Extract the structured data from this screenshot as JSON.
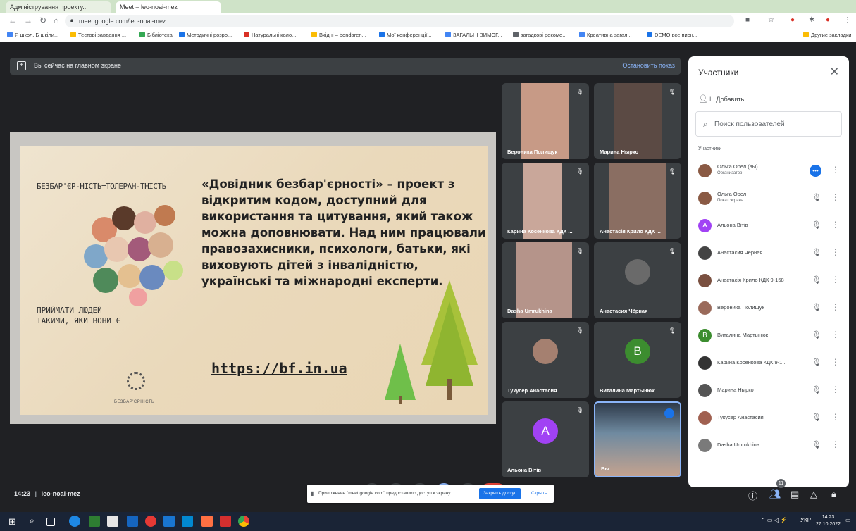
{
  "browser": {
    "tabs": [
      {
        "label": "Адміністрування проекту..."
      },
      {
        "label": "Meet – leo-noai-mez"
      }
    ],
    "url": "meet.google.com/leo-noai-mez",
    "bookmarks": [
      {
        "label": "Я школ. Б шкіли...",
        "color": "#4285f4"
      },
      {
        "label": "Тестові завдання ...",
        "color": "#fbbc04"
      },
      {
        "label": "Бібліотека",
        "color": "#34a853"
      },
      {
        "label": "Методичні розро...",
        "color": "#1a73e8"
      },
      {
        "label": "Натуральні коло...",
        "color": "#d93025"
      },
      {
        "label": "Вхідні – bondaren...",
        "color": "#fbbc04"
      },
      {
        "label": "Мої конференції...",
        "color": "#1a73e8"
      },
      {
        "label": "ЗАГАЛЬНІ ВИМОГ...",
        "color": "#4285f4"
      },
      {
        "label": "загадкові рекоме...",
        "color": "#5f6368"
      },
      {
        "label": "Креативна загал...",
        "color": "#4285f4"
      },
      {
        "label": "DEMO все писн...",
        "color": "#1a73e8"
      }
    ],
    "other_bookmarks": "Другие закладки"
  },
  "meet": {
    "present_bar": {
      "text": "Вы сейчас на главном экране",
      "stop": "Остановить показ"
    },
    "slide": {
      "hand_title": "БЕЗБАР'ЄР-НІСТЬ=ТОЛЕРАН-ТНІСТЬ",
      "hand_caption": "ПРИЙМАТИ ЛЮДЕЙ ТАКИМИ, ЯКИ ВОНИ Є",
      "main_text": "«Довідник безбар'єрності» – проект з відкритим кодом, доступний для використання та цитування, який також можна доповнювати. Над ним працювали правозахисники, психологи, батьки, які виховують дітей з інвалідністю, українські та міжнародні експерти.",
      "link": "https://bf.in.ua",
      "logo_text": "БЕЗБАР'ЄРНІСТЬ"
    },
    "tiles": [
      {
        "name": "Вероника Полищук",
        "type": "photo",
        "color": "#c79a86"
      },
      {
        "name": "Марина Ныркo",
        "type": "photo",
        "color": "#5b4a44"
      },
      {
        "name": "Карина Косенкова КДК ...",
        "type": "photo",
        "color": "#c9a79a"
      },
      {
        "name": "Анастасія Крило КДК ...",
        "type": "photo",
        "color": "#8a6e62"
      },
      {
        "name": "Dasha Umrukhina",
        "type": "photo",
        "color": "#b5948a"
      },
      {
        "name": "Анастасия Чёрная",
        "type": "photo",
        "color": "#6a6a6a"
      },
      {
        "name": "Тукусер Анастасия",
        "type": "photo",
        "color": "#a58070"
      },
      {
        "name": "Виталина Мартынюк",
        "type": "letter",
        "letter": "B",
        "color": "#3c8d2f"
      },
      {
        "name": "Альона Вітів",
        "type": "letter",
        "letter": "A",
        "color": "#a142f4"
      },
      {
        "name": "Вы",
        "type": "photo",
        "color": "#6f8aa0"
      }
    ],
    "panel": {
      "title": "Участники",
      "add": "Добавить",
      "search_placeholder": "Поиск пользователей",
      "section": "Участники",
      "people": [
        {
          "name": "Ольга Орел (вы)",
          "sub": "Организатор",
          "color": "#8a5a44",
          "state": "speaking"
        },
        {
          "name": "Ольга Орел",
          "sub": "Показ экрана",
          "color": "#8a5a44",
          "state": "present"
        },
        {
          "name": "Альона Вітів",
          "sub": "",
          "color": "#a142f4",
          "letter": "A",
          "state": "muted"
        },
        {
          "name": "Анастасия Чёрная",
          "sub": "",
          "color": "#444",
          "state": "muted"
        },
        {
          "name": "Анастасія Крило КДК 9-158",
          "sub": "",
          "color": "#7a5040",
          "state": "muted"
        },
        {
          "name": "Вероника Полищук",
          "sub": "",
          "color": "#9a6a5a",
          "state": "muted"
        },
        {
          "name": "Виталина Мартынюк",
          "sub": "",
          "color": "#3c8d2f",
          "letter": "B",
          "state": "muted"
        },
        {
          "name": "Карина Косенкова КДК 9-1...",
          "sub": "",
          "color": "#333",
          "state": "muted"
        },
        {
          "name": "Марина Ныркo",
          "sub": "",
          "color": "#555",
          "state": "muted"
        },
        {
          "name": "Тукусер Анастасия",
          "sub": "",
          "color": "#a06050",
          "state": "muted"
        },
        {
          "name": "Dasha Umrukhina",
          "sub": "",
          "color": "#7a7a7a",
          "state": "muted"
        }
      ]
    },
    "bottom": {
      "time": "14:23",
      "code": "leo-noai-mez",
      "notification": "Приложение \"meet.google.com\" предоставило доступ к экрану.",
      "notify_button": "Закрыть доступ",
      "notify_hide": "Скрыть",
      "participants_count": "11"
    }
  },
  "taskbar": {
    "lang": "УКР",
    "time": "14:23",
    "date": "27.10.2022"
  }
}
